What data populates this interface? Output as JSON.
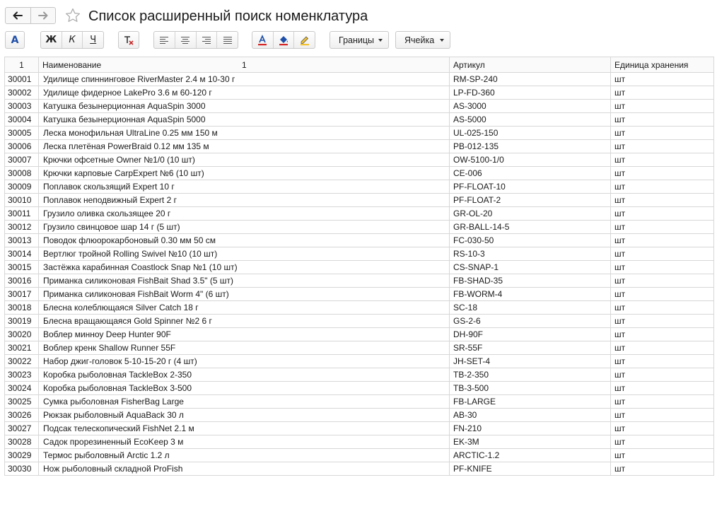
{
  "window": {
    "title": "Список расширенный поиск номенклатура"
  },
  "toolbar": {
    "font_label": "A",
    "bold_label": "Ж",
    "italic_label": "К",
    "underline_label": "Ч",
    "font_color_label": "A",
    "borders_label": "Границы",
    "cell_label": "Ячейка",
    "accent_color": "#1f4fa8",
    "font_color_bar": "#d62828",
    "fill_color_bar": "#f2c230"
  },
  "table": {
    "headers": {
      "number": "1",
      "name": "Наименование",
      "name_column_number": "1",
      "sku": "Артикул",
      "unit": "Единица хранения"
    },
    "rows": [
      {
        "code": "30001",
        "name": "Удилище спиннинговое RiverMaster 2.4 м 10-30 г",
        "sku": "RM-SP-240",
        "unit": "шт"
      },
      {
        "code": "30002",
        "name": "Удилище фидерное LakePro 3.6 м 60-120 г",
        "sku": "LP-FD-360",
        "unit": "шт"
      },
      {
        "code": "30003",
        "name": "Катушка безынерционная AquaSpin 3000",
        "sku": "AS-3000",
        "unit": "шт"
      },
      {
        "code": "30004",
        "name": "Катушка безынерционная AquaSpin 5000",
        "sku": "AS-5000",
        "unit": "шт"
      },
      {
        "code": "30005",
        "name": "Леска монофильная UltraLine 0.25 мм 150 м",
        "sku": "UL-025-150",
        "unit": "шт"
      },
      {
        "code": "30006",
        "name": "Леска плетёная PowerBraid 0.12 мм 135 м",
        "sku": "PB-012-135",
        "unit": "шт"
      },
      {
        "code": "30007",
        "name": "Крючки офсетные Owner №1/0 (10 шт)",
        "sku": "OW-5100-1/0",
        "unit": "шт"
      },
      {
        "code": "30008",
        "name": "Крючки карповые CarpExpert №6 (10 шт)",
        "sku": "CE-006",
        "unit": "шт"
      },
      {
        "code": "30009",
        "name": "Поплавок скользящий Expert 10 г",
        "sku": "PF-FLOAT-10",
        "unit": "шт"
      },
      {
        "code": "30010",
        "name": "Поплавок неподвижный Expert 2 г",
        "sku": "PF-FLOAT-2",
        "unit": "шт"
      },
      {
        "code": "30011",
        "name": "Грузило оливка скользящее 20 г",
        "sku": "GR-OL-20",
        "unit": "шт"
      },
      {
        "code": "30012",
        "name": "Грузило свинцовое шар 14 г (5 шт)",
        "sku": "GR-BALL-14-5",
        "unit": "шт"
      },
      {
        "code": "30013",
        "name": "Поводок флюорокарбоновый 0.30 мм 50 см",
        "sku": "FC-030-50",
        "unit": "шт"
      },
      {
        "code": "30014",
        "name": "Вертлюг тройной Rolling Swivel №10 (10 шт)",
        "sku": "RS-10-3",
        "unit": "шт"
      },
      {
        "code": "30015",
        "name": "Застёжка карабинная Coastlock Snap №1 (10 шт)",
        "sku": "CS-SNAP-1",
        "unit": "шт"
      },
      {
        "code": "30016",
        "name": "Приманка силиконовая FishBait Shad 3.5\" (5 шт)",
        "sku": "FB-SHAD-35",
        "unit": "шт"
      },
      {
        "code": "30017",
        "name": "Приманка силиконовая FishBait Worm 4\" (6 шт)",
        "sku": "FB-WORM-4",
        "unit": "шт"
      },
      {
        "code": "30018",
        "name": "Блесна колеблющаяся Silver Catch 18 г",
        "sku": "SC-18",
        "unit": "шт"
      },
      {
        "code": "30019",
        "name": "Блесна вращающаяся Gold Spinner №2 6 г",
        "sku": "GS-2-6",
        "unit": "шт"
      },
      {
        "code": "30020",
        "name": "Воблер минноу Deep Hunter 90F",
        "sku": "DH-90F",
        "unit": "шт"
      },
      {
        "code": "30021",
        "name": "Воблер кренк Shallow Runner 55F",
        "sku": "SR-55F",
        "unit": "шт"
      },
      {
        "code": "30022",
        "name": "Набор джиг-головок 5-10-15-20 г (4 шт)",
        "sku": "JH-SET-4",
        "unit": "шт"
      },
      {
        "code": "30023",
        "name": "Коробка рыболовная TackleBox 2-350",
        "sku": "TB-2-350",
        "unit": "шт"
      },
      {
        "code": "30024",
        "name": "Коробка рыболовная TackleBox 3-500",
        "sku": "TB-3-500",
        "unit": "шт"
      },
      {
        "code": "30025",
        "name": "Сумка рыболовная FisherBag Large",
        "sku": "FB-LARGE",
        "unit": "шт"
      },
      {
        "code": "30026",
        "name": "Рюкзак рыболовный AquaBack 30 л",
        "sku": "AB-30",
        "unit": "шт"
      },
      {
        "code": "30027",
        "name": "Подсак телескопический FishNet 2.1 м",
        "sku": "FN-210",
        "unit": "шт"
      },
      {
        "code": "30028",
        "name": "Садок прорезиненный EcoKeep 3 м",
        "sku": "EK-3M",
        "unit": "шт"
      },
      {
        "code": "30029",
        "name": "Термос рыболовный Arctic 1.2 л",
        "sku": "ARCTIC-1.2",
        "unit": "шт"
      },
      {
        "code": "30030",
        "name": "Нож рыболовный складной ProFish",
        "sku": "PF-KNIFE",
        "unit": "шт"
      }
    ]
  }
}
